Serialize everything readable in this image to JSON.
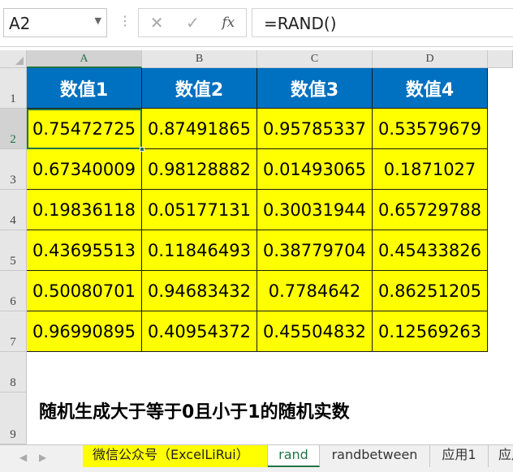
{
  "name_box": "A2",
  "formula": "=RAND()",
  "formula_buttons": {
    "cancel": "✕",
    "enter": "✓",
    "fx": "fx"
  },
  "columns": [
    "A",
    "B",
    "C",
    "D"
  ],
  "rows": [
    "1",
    "2",
    "3",
    "4",
    "5",
    "6",
    "7",
    "8",
    "9"
  ],
  "headers": [
    "数值1",
    "数值2",
    "数值3",
    "数值4"
  ],
  "values": [
    [
      "0.75472725",
      "0.87491865",
      "0.95785337",
      "0.53579679"
    ],
    [
      "0.67340009",
      "0.98128882",
      "0.01493065",
      "0.1871027"
    ],
    [
      "0.19836118",
      "0.05177131",
      "0.30031944",
      "0.65729788"
    ],
    [
      "0.43695513",
      "0.11846493",
      "0.38779704",
      "0.45433826"
    ],
    [
      "0.50080701",
      "0.94683432",
      "0.7784642",
      "0.86251205"
    ],
    [
      "0.96990895",
      "0.40954372",
      "0.45504832",
      "0.12569263"
    ]
  ],
  "note": "随机生成大于等于0且小于1的随机实数",
  "sheet_tabs": [
    "微信公众号（ExcelLiRui）",
    "rand",
    "randbetween",
    "应用1",
    "应用"
  ],
  "active_tab": "rand",
  "colors": {
    "header_bg": "#0070c0",
    "data_bg": "#ffff00",
    "accent": "#217346"
  }
}
